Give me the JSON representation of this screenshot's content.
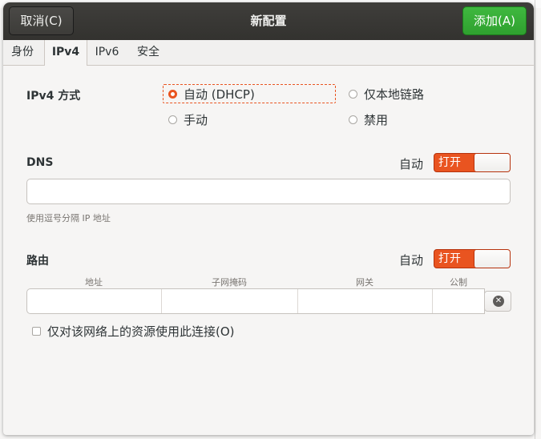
{
  "header": {
    "cancel_label": "取消(C)",
    "title": "新配置",
    "add_label": "添加(A)"
  },
  "tabs": [
    {
      "label": "身份"
    },
    {
      "label": "IPv4"
    },
    {
      "label": "IPv6"
    },
    {
      "label": "安全"
    }
  ],
  "ipv4": {
    "method_label": "IPv4 方式",
    "options": {
      "auto_dhcp": "自动 (DHCP)",
      "link_local": "仅本地链路",
      "manual": "手动",
      "disabled": "禁用"
    },
    "selected": "自动 (DHCP)"
  },
  "dns": {
    "label": "DNS",
    "auto_label": "自动",
    "switch_label": "打开",
    "value": "",
    "hint": "使用逗号分隔 IP 地址"
  },
  "routes": {
    "label": "路由",
    "auto_label": "自动",
    "switch_label": "打开",
    "columns": [
      "地址",
      "子网掩码",
      "网关",
      "公制"
    ],
    "only_local_label": "仅对该网络上的资源使用此连接(O)"
  },
  "colors": {
    "accent": "#e95420",
    "add_button": "#33a633",
    "header": "#3a3936"
  }
}
